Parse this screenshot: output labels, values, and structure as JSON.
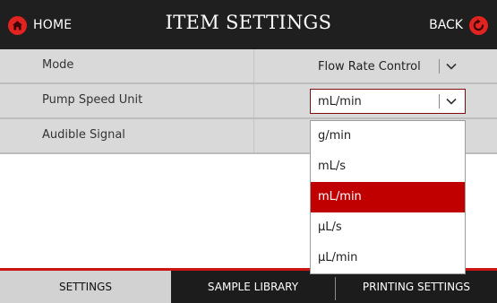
{
  "header": {
    "home_label": "HOME",
    "title": "ITEM SETTINGS",
    "back_label": "BACK"
  },
  "icons": {
    "home": "home-icon",
    "back": "back-arrow-icon",
    "chevron": "chevron-down-icon"
  },
  "colors": {
    "accent": "#e2231f",
    "selected_option": "#c00000",
    "header_bg": "#1f1f1f",
    "row_bg": "#d9d9d9"
  },
  "settings": [
    {
      "label": "Mode",
      "value": "Flow Rate Control"
    },
    {
      "label": "Pump Speed Unit",
      "value": "mL/min"
    },
    {
      "label": "Audible Signal",
      "value": ""
    }
  ],
  "dropdown": {
    "options": [
      "g/min",
      "mL/s",
      "mL/min",
      "µL/s",
      "µL/min"
    ],
    "selected": "mL/min"
  },
  "tabs": [
    {
      "label": "SETTINGS",
      "active": true
    },
    {
      "label": "SAMPLE LIBRARY",
      "active": false
    },
    {
      "label": "PRINTING SETTINGS",
      "active": false
    }
  ]
}
